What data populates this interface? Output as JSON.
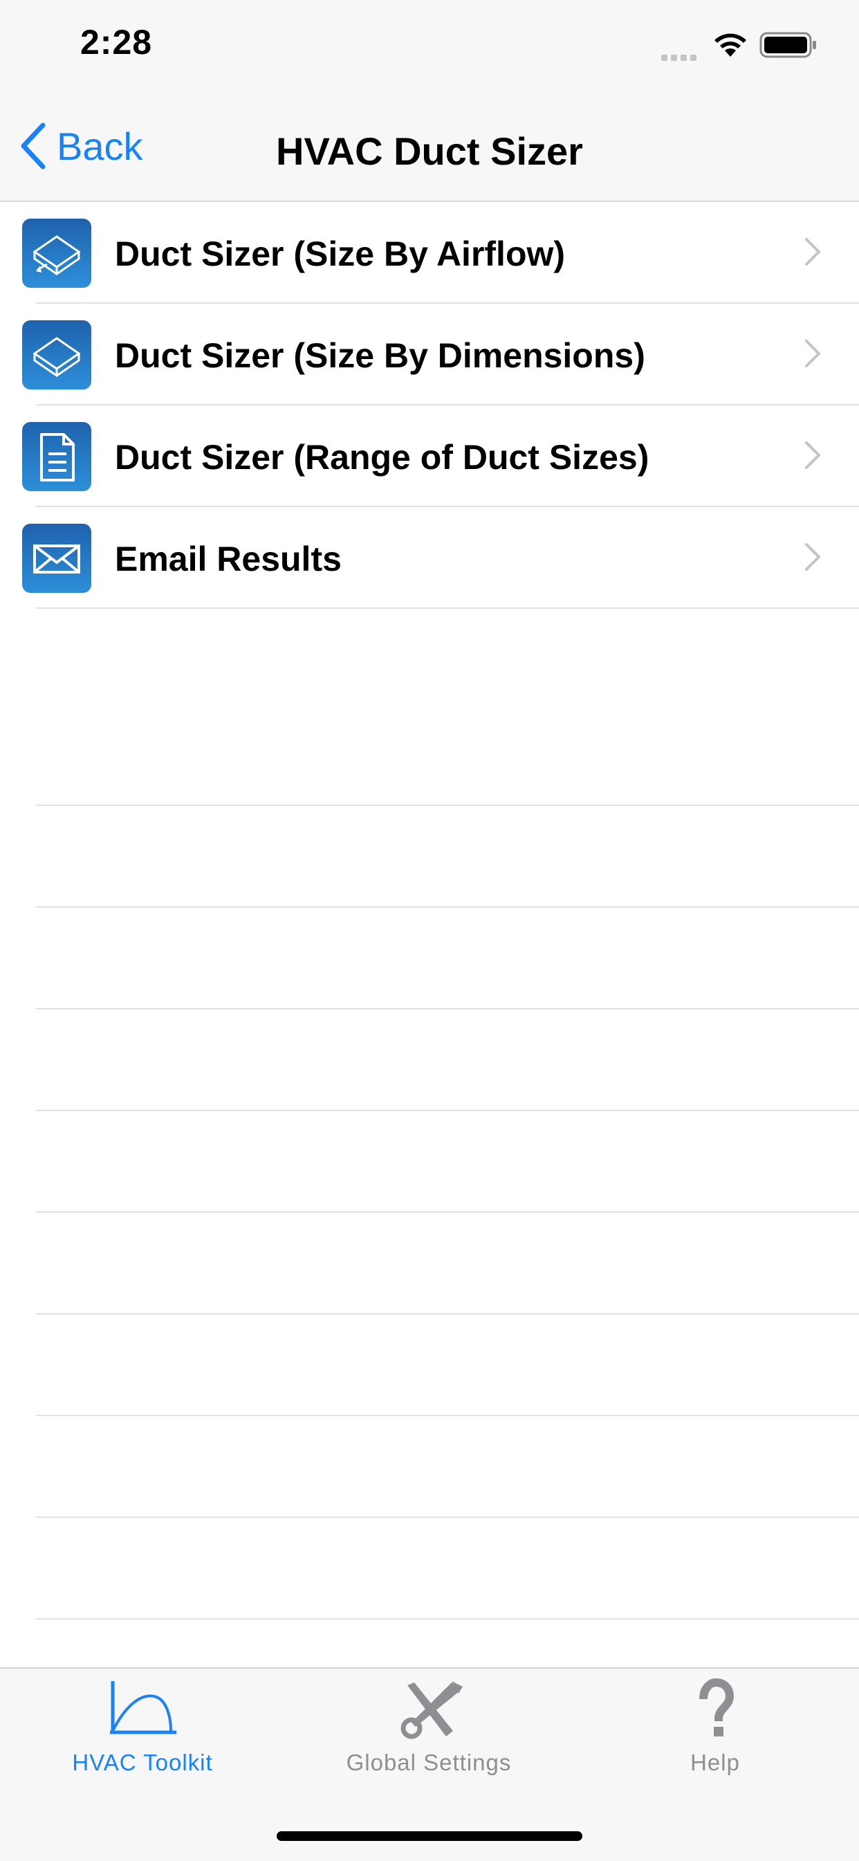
{
  "status_bar": {
    "time": "2:28"
  },
  "nav": {
    "back_label": "Back",
    "title": "HVAC Duct Sizer"
  },
  "menu": {
    "items": [
      {
        "label": "Duct Sizer (Size By Airflow)",
        "icon": "duct-box-icon"
      },
      {
        "label": "Duct Sizer (Size By Dimensions)",
        "icon": "duct-box-icon"
      },
      {
        "label": "Duct Sizer (Range of Duct Sizes)",
        "icon": "document-icon"
      },
      {
        "label": "Email Results",
        "icon": "envelope-icon"
      }
    ]
  },
  "tabs": [
    {
      "label": "HVAC Toolkit",
      "icon": "curve-chart-icon",
      "active": true
    },
    {
      "label": "Global Settings",
      "icon": "wrench-screwdriver-icon",
      "active": false
    },
    {
      "label": "Help",
      "icon": "question-mark-icon",
      "active": false
    }
  ],
  "colors": {
    "accent": "#1a82f7",
    "icon_gradient_top": "#1f62ad",
    "icon_gradient_bottom": "#2d8fd8",
    "inactive_tab": "#8e8e93"
  }
}
